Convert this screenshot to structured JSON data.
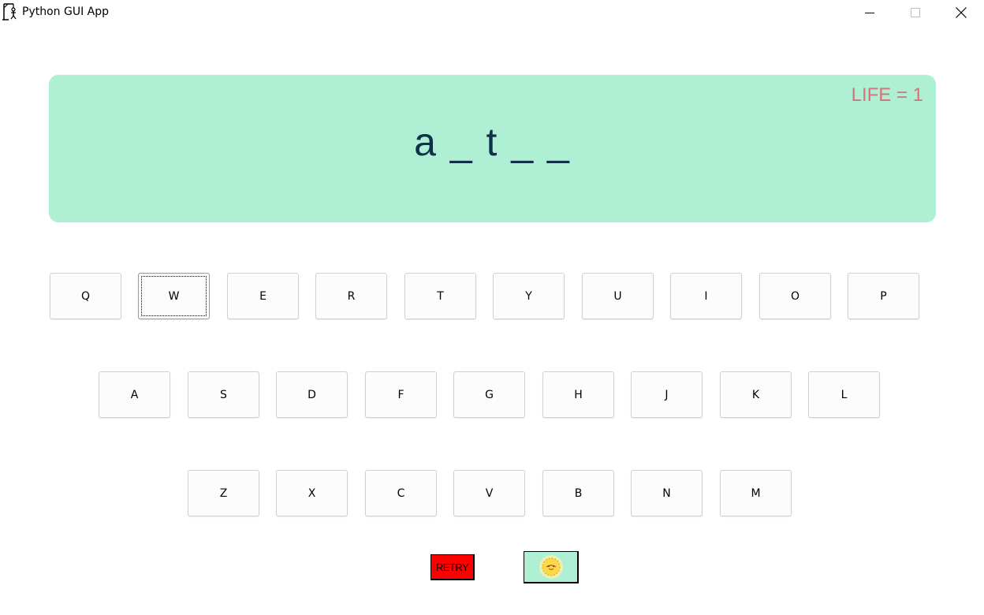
{
  "window": {
    "title": "Python GUI App"
  },
  "game": {
    "life_label": "LIFE = 1",
    "word_display": "a _ t _ _",
    "colors": {
      "panel": "#aff0d4",
      "life": "#d6727a",
      "word": "#0e3148",
      "retry": "#ff0000"
    }
  },
  "keyboard": {
    "row1": [
      "Q",
      "W",
      "E",
      "R",
      "T",
      "Y",
      "U",
      "I",
      "O",
      "P"
    ],
    "row2": [
      "A",
      "S",
      "D",
      "F",
      "G",
      "H",
      "J",
      "K",
      "L"
    ],
    "row3": [
      "Z",
      "X",
      "C",
      "V",
      "B",
      "N",
      "M"
    ],
    "focused_key": "W"
  },
  "controls": {
    "retry_label": "RETRY",
    "hint_icon": "sun-hint-icon"
  }
}
